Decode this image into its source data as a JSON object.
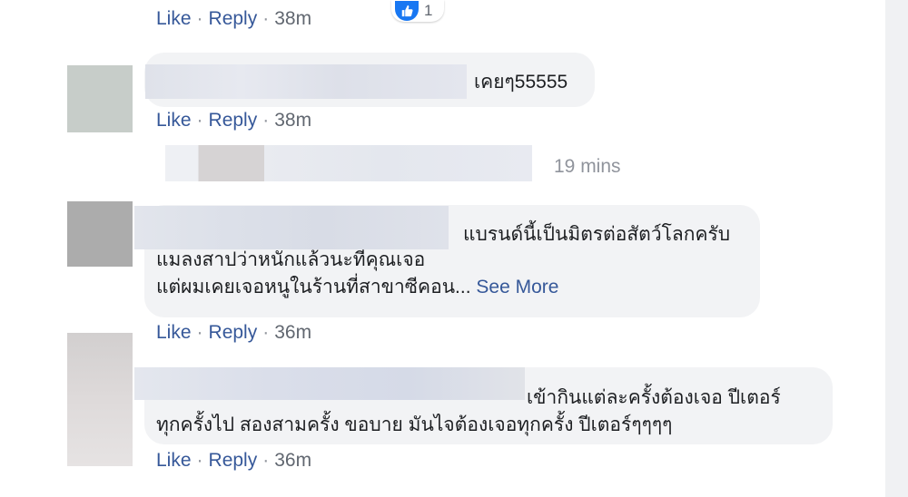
{
  "actions": {
    "like": "Like",
    "reply": "Reply",
    "sep": "·"
  },
  "comments": [
    {
      "time": "38m",
      "reaction_count": "1"
    },
    {
      "text": "เคยๆ55555",
      "time": "38m"
    },
    {
      "reply_preview_time": "19 mins"
    },
    {
      "lines": [
        "แบรนด์นี้เป็นมิตรต่อสัตว์โลกครับ",
        "แมลงสาปว่าหนักแล้วนะทีคุณเจอ",
        "แต่ผมเคยเจอหนูในร้านที่สาขาซีคอน..."
      ],
      "see_more": "See More",
      "time": "36m"
    },
    {
      "lines": [
        "เข้ากินแต่ละครั้งต้องเจอ ปีเตอร์",
        "ทุกครั้งไป สองสามครั้ง ขอบาย มันไจต้องเจอทุกครั้ง ปีเตอร์ๆๆๆๆ"
      ],
      "time": "36m"
    }
  ],
  "colors": {
    "link": "#365899",
    "bubble": "#f2f3f5",
    "like_blue": "#1877f2"
  },
  "icons": [
    "like-icon"
  ]
}
